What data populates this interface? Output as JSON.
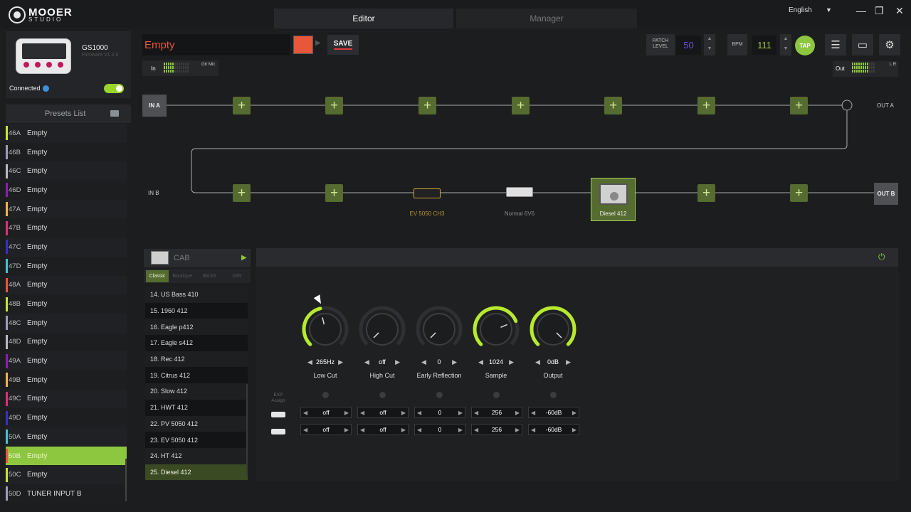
{
  "app": {
    "brand": "MOOER",
    "brand_sub": "STUDIO"
  },
  "tabs": {
    "editor": "Editor",
    "manager": "Manager"
  },
  "language": "English",
  "device": {
    "name": "GS1000",
    "firmware": "Firmware V1.2.0",
    "status": "Connected"
  },
  "presets_header": "Presets List",
  "presets": [
    {
      "id": "46A",
      "name": "Empty",
      "color": "#c8e636"
    },
    {
      "id": "46B",
      "name": "Empty",
      "color": "#9aa0b4"
    },
    {
      "id": "46C",
      "name": "Empty",
      "color": "#b7bac2"
    },
    {
      "id": "46D",
      "name": "Empty",
      "color": "#8a1fb5"
    },
    {
      "id": "47A",
      "name": "Empty",
      "color": "#f0b54a"
    },
    {
      "id": "47B",
      "name": "Empty",
      "color": "#e02e76"
    },
    {
      "id": "47C",
      "name": "Empty",
      "color": "#3a2fc6"
    },
    {
      "id": "47D",
      "name": "Empty",
      "color": "#45c2d4"
    },
    {
      "id": "48A",
      "name": "Empty",
      "color": "#e8573a"
    },
    {
      "id": "48B",
      "name": "Empty",
      "color": "#c8e636"
    },
    {
      "id": "48C",
      "name": "Empty",
      "color": "#9aa0b4"
    },
    {
      "id": "48D",
      "name": "Empty",
      "color": "#b7bac2"
    },
    {
      "id": "49A",
      "name": "Empty",
      "color": "#8a1fb5"
    },
    {
      "id": "49B",
      "name": "Empty",
      "color": "#f0b54a"
    },
    {
      "id": "49C",
      "name": "Empty",
      "color": "#e02e76"
    },
    {
      "id": "49D",
      "name": "Empty",
      "color": "#3a2fc6"
    },
    {
      "id": "50A",
      "name": "Empty",
      "color": "#45c2d4"
    },
    {
      "id": "50B",
      "name": "Empty",
      "color": "#e8573a",
      "selected": true
    },
    {
      "id": "50C",
      "name": "Empty",
      "color": "#c8e636"
    },
    {
      "id": "50D",
      "name": "TUNER INPUT B",
      "color": "#9aa0b4"
    }
  ],
  "header": {
    "preset_name": "Empty",
    "preset_color": "#e8573a",
    "save": "SAVE",
    "patch_level_label": "PATCH LEVEL",
    "patch_level": "50",
    "bpm_label": "BPM",
    "bpm": "111",
    "tap": "TAP",
    "in_label": "In",
    "in_sources": "Gtr Mic",
    "out_label": "Out",
    "out_channels": "L R"
  },
  "chain": {
    "in_a": "IN A",
    "in_b": "IN B",
    "out_a": "OUT A",
    "out_b": "OUT B",
    "slots_row_a": 7,
    "effects": [
      {
        "name": "EV 5050 CH3"
      },
      {
        "name": "Normal 6V6"
      },
      {
        "name": "Diesel 412",
        "selected": true
      }
    ]
  },
  "cab": {
    "title": "CAB",
    "tabs": [
      "Classic",
      "Boutique",
      "BASS",
      "GIR"
    ],
    "active_tab": "Classic",
    "items": [
      "14. US Bass 410",
      "15. 1960 412",
      "16. Eagle p412",
      "17. Eagle s412",
      "18. Rec 412",
      "19. Citrus 412",
      "20. Slow 412",
      "21. HWT 412",
      "22. PV 5050 412",
      "23. EV 5050 412",
      "24. HT 412",
      "25. Diesel 412"
    ],
    "selected": "25. Diesel 412"
  },
  "params": [
    {
      "name": "Low Cut",
      "value": "265Hz",
      "exp1": "off",
      "exp2": "off",
      "level": 0.45
    },
    {
      "name": "High Cut",
      "value": "off",
      "exp1": "off",
      "exp2": "off",
      "level": 0.0
    },
    {
      "name": "Early Reflection",
      "value": "0",
      "exp1": "0",
      "exp2": "0",
      "level": 0.0
    },
    {
      "name": "Sample",
      "value": "1024",
      "exp1": "256",
      "exp2": "256",
      "level": 0.75
    },
    {
      "name": "Output",
      "value": "0dB",
      "exp1": "-60dB",
      "exp2": "-60dB",
      "level": 1.0
    }
  ],
  "exp_assign": "EXP Assign",
  "accent": "#8dc63f"
}
